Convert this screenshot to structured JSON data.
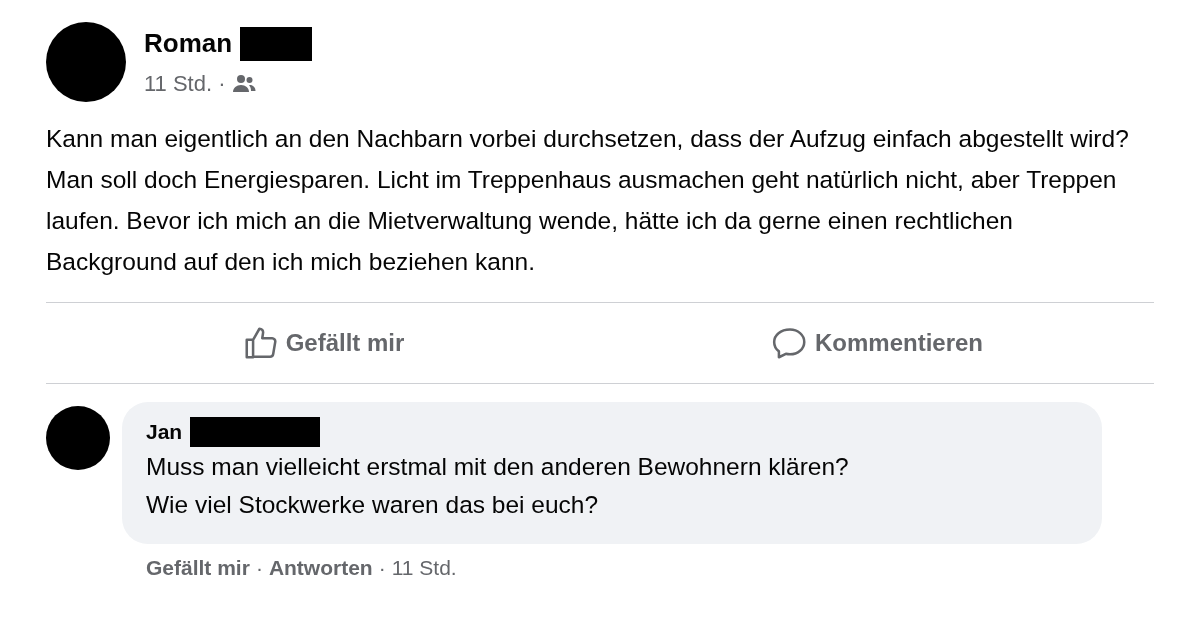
{
  "post": {
    "author": "Roman",
    "time": "11 Std. ·",
    "text": "Kann man eigentlich an den Nachbarn vorbei durchsetzen, dass der Aufzug einfach abgestellt wird? Man soll doch Energiesparen. Licht im Treppenhaus ausmachen geht natürlich nicht, aber Treppen laufen. Bevor ich mich an die Mietverwaltung wende, hätte ich da gerne einen rechtlichen Background auf den ich mich beziehen kann."
  },
  "actions": [
    {
      "kind": "like",
      "label": "Gefällt mir"
    },
    {
      "kind": "comment",
      "label": "Kommentieren"
    }
  ],
  "comment": {
    "author": "Jan",
    "lines": [
      "Muss man vielleicht erstmal mit den anderen Bewohnern klären?",
      "Wie viel Stockwerke waren das bei euch?"
    ],
    "links": [
      "Gefällt mir",
      "Antworten"
    ],
    "separator": "·",
    "time": "11 Std."
  }
}
